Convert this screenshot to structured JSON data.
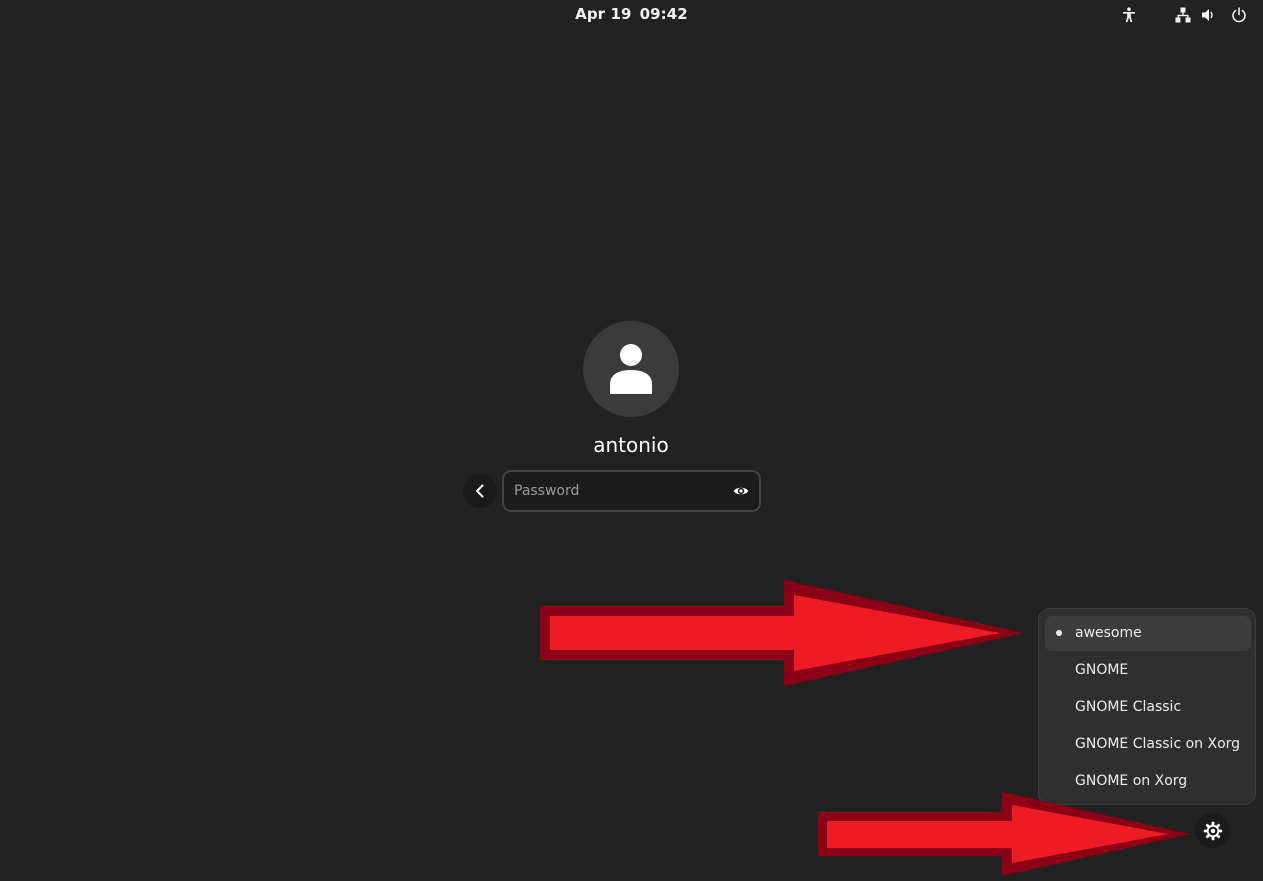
{
  "topbar": {
    "date": "Apr 19",
    "time": "09:42",
    "icons": [
      "accessibility-icon",
      "network-icon",
      "volume-icon",
      "power-icon"
    ]
  },
  "login": {
    "username": "antonio",
    "password_placeholder": "Password",
    "password_value": ""
  },
  "session_menu": {
    "items": [
      {
        "label": "awesome",
        "selected": true
      },
      {
        "label": "GNOME",
        "selected": false
      },
      {
        "label": "GNOME Classic",
        "selected": false
      },
      {
        "label": "GNOME Classic on Xorg",
        "selected": false
      },
      {
        "label": "GNOME on Xorg",
        "selected": false
      }
    ]
  },
  "colors": {
    "background": "#222222",
    "menu_background": "#2f2f2f",
    "arrow_fill": "#ed1c24",
    "arrow_outline": "#8b0014"
  }
}
